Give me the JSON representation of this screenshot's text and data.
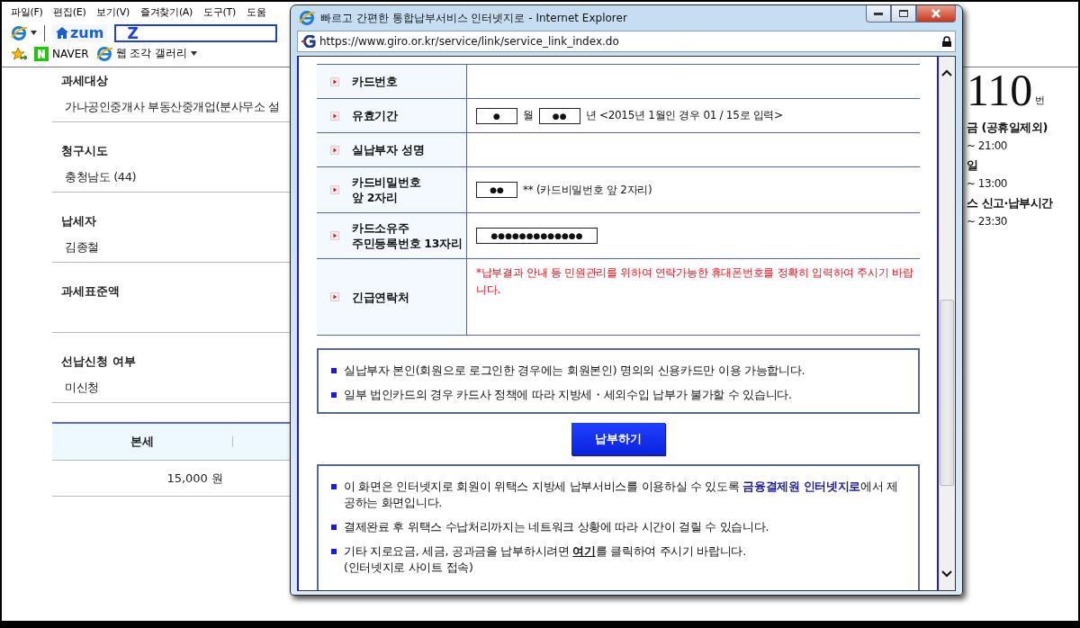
{
  "browser": {
    "menu": [
      "파일(F)",
      "편집(E)",
      "보기(V)",
      "즐겨찾기(A)",
      "도구(T)",
      "도움"
    ],
    "toolbar": {
      "logo": "zum",
      "address": "Z"
    },
    "favorites": [
      {
        "kind": "naver",
        "label": "NAVER"
      },
      {
        "kind": "gallery",
        "label": "웹 조각 갤러리"
      }
    ]
  },
  "tax_form": {
    "fields": [
      {
        "label": "과세대상",
        "value": "가나공인중개사 부동산중개업(분사무소 설"
      },
      {
        "label": "청구시도",
        "value": "충청남도 (44)"
      },
      {
        "label": "납세자",
        "value": "김종철"
      },
      {
        "label": "과세표준액"
      },
      {
        "label": "선납신청 여부",
        "value": "미신청"
      }
    ],
    "table": {
      "columns": [
        "본세"
      ],
      "rows": [
        [
          "15,000 원"
        ]
      ]
    }
  },
  "info_panel": {
    "number": "110",
    "unit": "번",
    "lines": [
      {
        "kind": "heading",
        "text": "금 (공휴일제외)"
      },
      {
        "kind": "time",
        "text": "~ 21:00"
      },
      {
        "kind": "heading",
        "text": "일"
      },
      {
        "kind": "time",
        "text": "~ 13:00"
      },
      {
        "kind": "heading",
        "text": "스 신고·납부시간"
      },
      {
        "kind": "time",
        "text": "~ 23:30"
      }
    ]
  },
  "popup": {
    "title": "빠르고 간편한 통합납부서비스 인터넷지로 - Internet Explorer",
    "url": "https://www.giro.or.kr/service/link/service_link_index.do",
    "form_rows": [
      {
        "label": [
          "카드번호"
        ]
      },
      {
        "label": [
          "유효기간"
        ],
        "content": [
          {
            "kind": "field",
            "value": "●"
          },
          {
            "kind": "text",
            "text": "월"
          },
          {
            "kind": "field",
            "value": "●●"
          },
          {
            "kind": "text",
            "text": "년 <2015년 1월인 경우 01 / 15로 입력>"
          }
        ]
      },
      {
        "label": [
          "실납부자 성명"
        ]
      },
      {
        "label": [
          "카드비밀번호",
          "앞 2자리"
        ],
        "content": [
          {
            "kind": "field",
            "value": "●●"
          },
          {
            "kind": "text",
            "text": "** (카드비밀번호 앞 2자리)"
          }
        ]
      },
      {
        "label": [
          "카드소유주",
          "주민등록번호 13자리"
        ],
        "content": [
          {
            "kind": "field",
            "value": "●●●●●●●●●●●●●"
          }
        ]
      },
      {
        "label": [
          "긴급연락처"
        ],
        "content": [
          {
            "kind": "notice",
            "text": "*납부결과 안내 등 민원관리를 위하여 연락가능한 휴대폰번호를 정확히 입력하여 주시기 바랍니다."
          }
        ]
      }
    ],
    "notices": [
      "실납부자 본인(회원으로 로그인한 경우에는 회원본인) 명의의 신용카드만 이용 가능합니다.",
      "일부 법인카드의 경우 카드사 정책에 따라 지방세・세외수입 납부가 불가할 수 있습니다."
    ],
    "submit_button": "납부하기",
    "info": [
      {
        "segments": [
          {
            "kind": "text",
            "text": "이 화면은 인터넷지로 회원이 위택스 지방세 납부서비스를 이용하실 수 있도록 "
          },
          {
            "kind": "emphasis",
            "text": "금융결제원 인터넷지로"
          },
          {
            "kind": "text",
            "text": "에서 제공하는 화면입니다."
          }
        ]
      },
      {
        "segments": [
          {
            "kind": "text",
            "text": "결제완료 후 위택스 수납처리까지는 네트워크 상황에 따라 시간이 걸릴 수 있습니다."
          }
        ]
      },
      {
        "segments": [
          {
            "kind": "text",
            "text": "기타 지로요금, 세금, 공과금을 납부하시려면 "
          },
          {
            "kind": "link",
            "text": "여기"
          },
          {
            "kind": "text",
            "text": "를 클릭하여 주시기 바랍니다."
          }
        ],
        "note": "(인터넷지로 사이트 접속)"
      }
    ]
  }
}
